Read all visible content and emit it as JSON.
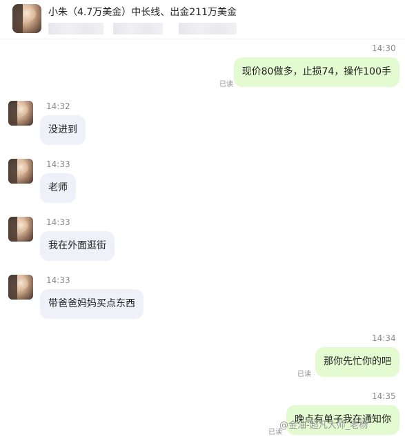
{
  "header": {
    "title": "小朱（4.7万美金）中长线、出金211万美金"
  },
  "messages": [
    {
      "time": "14:30",
      "text": "现价80做多，止损74，操作100手",
      "read": "已读"
    },
    {
      "time": "14:32",
      "text": "没进到"
    },
    {
      "time": "14:33",
      "text": "老师"
    },
    {
      "time": "14:33",
      "text": "我在外面逛街"
    },
    {
      "time": "14:33",
      "text": "带爸爸妈妈买点东西"
    },
    {
      "time": "14:34",
      "text": "那你先忙你的吧",
      "read": "已读"
    },
    {
      "time": "14:35",
      "text": "晚点有单子我在通知你",
      "read": "已读"
    }
  ],
  "watermark": "@金油-超凡大师_老杨",
  "colors": {
    "incoming_bubble": "#eef1f8",
    "outgoing_bubble": "#e4fbd2",
    "time_text": "#8a8a8a"
  }
}
